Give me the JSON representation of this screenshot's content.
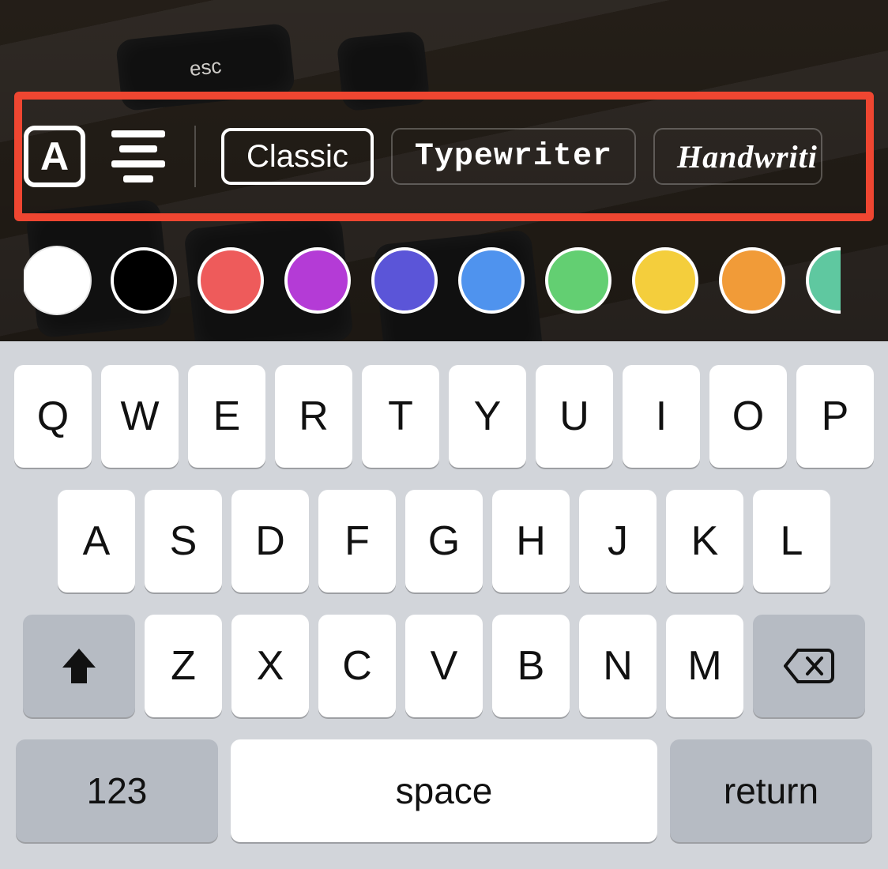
{
  "toolbar": {
    "text_style_icon_letter": "A",
    "fonts": [
      {
        "label": "Classic",
        "selected": true,
        "cls": ""
      },
      {
        "label": "Typewriter",
        "selected": false,
        "cls": "font-typewriter"
      },
      {
        "label": "Handwriti",
        "selected": false,
        "cls": "font-handwrite",
        "partial": true
      }
    ]
  },
  "colors": [
    {
      "hex": "#ffffff",
      "selected": true
    },
    {
      "hex": "#000000"
    },
    {
      "hex": "#ee5b5b"
    },
    {
      "hex": "#b43bd6"
    },
    {
      "hex": "#5b55d8"
    },
    {
      "hex": "#4f93ee"
    },
    {
      "hex": "#63cf72"
    },
    {
      "hex": "#f4ce3c"
    },
    {
      "hex": "#f19b38"
    },
    {
      "hex": "#5fc8a0",
      "partial": true
    }
  ],
  "keyboard": {
    "row1": [
      "Q",
      "W",
      "E",
      "R",
      "T",
      "Y",
      "U",
      "I",
      "O",
      "P"
    ],
    "row2": [
      "A",
      "S",
      "D",
      "F",
      "G",
      "H",
      "J",
      "K",
      "L"
    ],
    "row3": [
      "Z",
      "X",
      "C",
      "V",
      "B",
      "N",
      "M"
    ],
    "numbers_label": "123",
    "space_label": "space",
    "return_label": "return"
  }
}
